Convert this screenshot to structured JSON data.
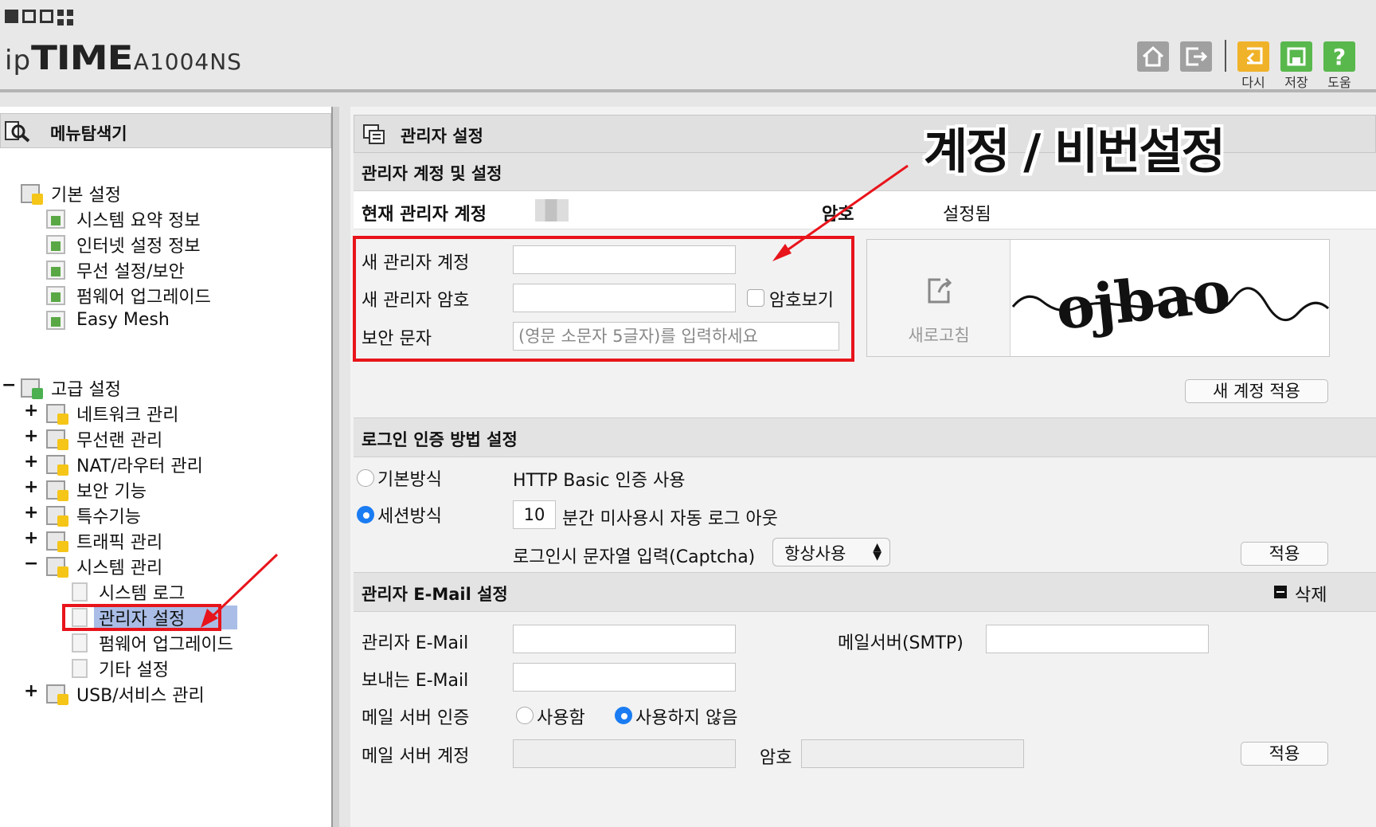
{
  "header": {
    "brand_prefix": "ip",
    "brand_main": "TIME",
    "model": "A1004NS",
    "buttons": {
      "reset_label": "다시",
      "save_label": "저장",
      "help_label": "도움"
    }
  },
  "sidebar": {
    "title": "메뉴탐색기",
    "basic": {
      "label": "기본 설정",
      "items": [
        "시스템 요약 정보",
        "인터넷 설정 정보",
        "무선 설정/보안",
        "펌웨어 업그레이드",
        "Easy Mesh"
      ]
    },
    "advanced": {
      "toggle": "−",
      "label": "고급 설정",
      "items": [
        "네트워크 관리",
        "무선랜 관리",
        "NAT/라우터 관리",
        "보안 기능",
        "특수기능",
        "트래픽 관리"
      ],
      "system": {
        "label": "시스템 관리",
        "items": [
          "시스템 로그",
          "관리자 설정",
          "펌웨어 업그레이드",
          "기타 설정"
        ]
      },
      "usb": "USB/서비스 관리"
    }
  },
  "main": {
    "title": "관리자 설정",
    "account": {
      "section": "관리자 계정 및 설정",
      "current_label": "현재 관리자 계정",
      "password_label": "암호",
      "password_status": "설정됨",
      "new_account_label": "새 관리자 계정",
      "new_password_label": "새 관리자 암호",
      "show_password_label": "암호보기",
      "security_text_label": "보안 문자",
      "security_placeholder": "(영문 소문자 5글자)를 입력하세요",
      "refresh_label": "새로고침",
      "captcha_text": "ojbao",
      "apply_label": "새 계정 적용"
    },
    "login": {
      "section": "로그인 인증 방법 설정",
      "basic_label": "기본방식",
      "basic_desc": "HTTP Basic 인증 사용",
      "session_label": "세션방식",
      "session_minutes": "10",
      "session_desc": "분간 미사용시 자동 로그 아웃",
      "captcha_label": "로그인시 문자열 입력(Captcha)",
      "captcha_option": "항상사용",
      "apply_label": "적용"
    },
    "email": {
      "section": "관리자 E-Mail 설정",
      "delete_label": "삭제",
      "admin_email_label": "관리자 E-Mail",
      "smtp_label": "메일서버(SMTP)",
      "sender_label": "보내는 E-Mail",
      "auth_label": "메일 서버 인증",
      "use_label": "사용함",
      "nouse_label": "사용하지 않음",
      "account_label": "메일 서버 계정",
      "password_label": "암호",
      "apply_label": "적용"
    }
  },
  "annotation": "계정 / 비번설정",
  "colors": {
    "highlight_red": "#e8141b",
    "radio_blue": "#1a7cf2",
    "selection": "#a9bde6"
  }
}
